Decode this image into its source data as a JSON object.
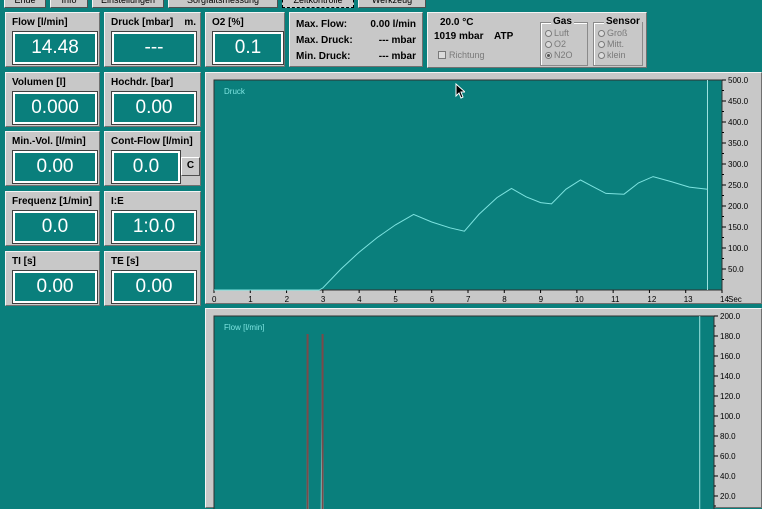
{
  "tabs": [
    {
      "label": "Ende"
    },
    {
      "label": "Info"
    },
    {
      "label": "Einstellungen"
    },
    {
      "label": "Sorgfaltsmessung"
    },
    {
      "label": "Zeitkontrolle",
      "active": true
    },
    {
      "label": "Werkzeug"
    }
  ],
  "tiles": {
    "flow": {
      "label": "Flow [l/min]",
      "value": "14.48"
    },
    "druck": {
      "label": "Druck [mbar]",
      "extra": "m.",
      "value": "---"
    },
    "o2": {
      "label": "O2 [%]",
      "value": "0.1"
    },
    "volumen": {
      "label": "Volumen [l]",
      "value": "0.000"
    },
    "hochdr": {
      "label": "Hochdr. [bar]",
      "value": "0.00"
    },
    "minvol": {
      "label": "Min.-Vol. [l/min]",
      "value": "0.00"
    },
    "contflow": {
      "label": "Cont-Flow [l/min]",
      "value": "0.0",
      "button": "C"
    },
    "frequenz": {
      "label": "Frequenz [1/min]",
      "value": "0.0"
    },
    "ie": {
      "label": "I:E",
      "value": "1:0.0"
    },
    "ti": {
      "label": "TI [s]",
      "value": "0.00"
    },
    "te": {
      "label": "TE [s]",
      "value": "0.00"
    }
  },
  "stats": {
    "max_flow_label": "Max. Flow:",
    "max_flow_value": "0.00 l/min",
    "max_druck_label": "Max. Druck:",
    "max_druck_value": "--- mbar",
    "min_druck_label": "Min. Druck:",
    "min_druck_value": "--- mbar"
  },
  "env": {
    "temperature": "20.0 °C",
    "pressure": "1019 mbar",
    "mode": "ATP",
    "richtung_label": "Richtung",
    "gas_title": "Gas",
    "gas_options": [
      "Luft",
      "O2",
      "N2O"
    ],
    "gas_selected": 2,
    "sensor_title": "Sensor",
    "sensor_options": [
      "Groß",
      "Mitt.",
      "klein"
    ],
    "sensor_selected": -1
  },
  "colors": {
    "background": "#0a7f7c",
    "panel": "#c8c8c8",
    "trace": "#7de3e0"
  },
  "chart_data": [
    {
      "type": "line",
      "title": "Druck",
      "xlabel": "Sec",
      "xlim": [
        0,
        14
      ],
      "ylim": [
        0,
        500
      ],
      "x_ticks": [
        0,
        1,
        2,
        3,
        4,
        5,
        6,
        7,
        8,
        9,
        10,
        11,
        12,
        13,
        14
      ],
      "y_ticks": [
        50,
        100,
        150,
        200,
        250,
        300,
        350,
        400,
        450,
        500
      ],
      "series": [
        {
          "x": [
            0,
            2.9,
            3.0,
            3.5,
            4.0,
            4.5,
            5.0,
            5.5,
            6.0,
            6.5,
            6.9,
            7.3,
            7.8,
            8.2,
            8.6,
            9.0,
            9.3,
            9.7,
            10.1,
            10.4,
            10.8,
            11.3,
            11.7,
            12.1,
            12.6,
            13.1,
            13.6
          ],
          "y": [
            0,
            0,
            5,
            50,
            90,
            125,
            155,
            180,
            162,
            148,
            140,
            180,
            220,
            242,
            222,
            208,
            205,
            240,
            262,
            248,
            230,
            228,
            255,
            270,
            258,
            245,
            240
          ]
        }
      ]
    },
    {
      "type": "line",
      "title": "Flow [l/min]",
      "xlim": [
        0,
        14
      ],
      "ylim": [
        0,
        200
      ],
      "y_ticks": [
        20,
        40,
        60,
        80,
        100,
        120,
        140,
        160,
        180,
        200
      ],
      "series": [
        {
          "x": [
            0,
            2.6,
            2.62,
            2.64,
            2.7,
            3.0,
            3.04,
            3.06,
            3.1,
            13.6
          ],
          "y": [
            0,
            0,
            170,
            0,
            0,
            0,
            170,
            0,
            0,
            0
          ]
        }
      ]
    }
  ]
}
